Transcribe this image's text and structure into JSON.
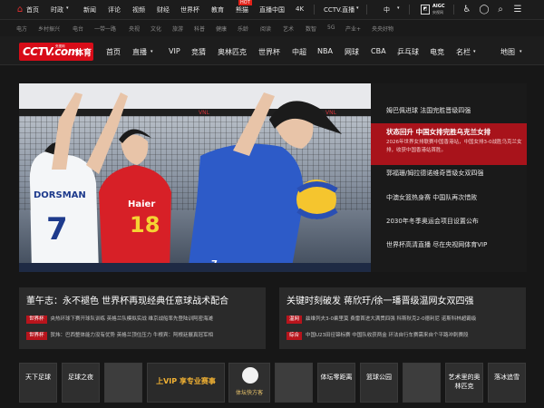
{
  "topbar": {
    "items": [
      "首页",
      "时政",
      "新闻",
      "评论",
      "视频",
      "财经",
      "世界杯",
      "教育",
      "熊猫",
      "直播中国",
      "4K",
      "CCTV.直播",
      "中"
    ],
    "hot_badge": "HOT",
    "aigc_label": "AIGC",
    "aigc_sub": "央视网",
    "icons": [
      "home-icon",
      "accessibility-icon",
      "user-icon",
      "search-icon",
      "menu-icon"
    ]
  },
  "subbar": {
    "items": [
      "电方",
      "乡村振兴",
      "电台",
      "一带一路",
      "央视",
      "文化",
      "旅游",
      "科普",
      "健康",
      "乐龄",
      "阅读",
      "艺术",
      "数智",
      "5G",
      "产业+",
      "央央好物"
    ]
  },
  "nav": {
    "logo_main": "CCTV.com",
    "logo_small": "央视网",
    "logo_suffix": "体育",
    "items": [
      "首页",
      "直播",
      "VIP",
      "竞猜",
      "奥林匹克",
      "世界杯",
      "中超",
      "NBA",
      "网球",
      "CBA",
      "乒乓球",
      "电竞",
      "名栏",
      "地图"
    ]
  },
  "hero": {
    "player_name": "DORSMAN",
    "player_number": "7",
    "player_number_red": "18",
    "sponsor": "Haier",
    "net_brand": "VNL"
  },
  "right_panel": {
    "items": [
      "姆巴佩进球 法国完胜晋级四强",
      "郭福珊/姆拉德诺维奇晋级女双四强",
      "中澳女篮热身赛 中国队再次惜败",
      "2030年冬季奥运会项目设置公布",
      "世界杯高清直播 尽在央视网体育VIP"
    ],
    "active": {
      "title": "状态回升 中国女排完胜乌克兰女排",
      "desc": "2026年世界女排联赛中国香港站，中国女排3-0战胜乌克兰女排，收获中国香港站首胜。"
    }
  },
  "cards": [
    {
      "title": "董午志：永不褪色 世界杯再现经典任意球战术配合",
      "rows": [
        {
          "tag": "世界杯",
          "text": "央热环球下赛开球队训练 英格兰队模拟实战 维京战船率先登陆训阿密海滩"
        },
        {
          "tag": "世界杯",
          "text": "贺炜：巴西整体能力没有优势 英格兰顶住压力 牛根宾：阿根廷展真冠军相"
        }
      ]
    },
    {
      "title": "关键时刻破发 蒋欣玗/徐一璠晋级温网女双四强",
      "rows": [
        {
          "tag": "温网",
          "text": "兹维列夫3-0乘里莫 费雷首进大满贯四强 科斯秋克2-0德利尼 诺斯科林超霸级"
        },
        {
          "tag": "综合",
          "text": "中国U23田径锦标赛 中国队收获两金 环法自行车赛需来自个平路冲刺赛段"
        }
      ]
    }
  ],
  "tiles": [
    {
      "label": "天下足球",
      "type": "text"
    },
    {
      "label": "足球之夜",
      "type": "text"
    },
    {
      "label": "",
      "type": "image"
    },
    {
      "label": "上VIP 享专业赛事",
      "type": "promo"
    },
    {
      "label": "体坛快方客",
      "type": "mascot"
    },
    {
      "label": "",
      "type": "image"
    },
    {
      "label": "体坛零距离",
      "type": "text"
    },
    {
      "label": "篮球公园",
      "type": "text"
    },
    {
      "label": "",
      "type": "image"
    },
    {
      "label": "艺术里的奥林匹克",
      "type": "text"
    },
    {
      "label": "落冰追雪",
      "type": "text"
    }
  ],
  "colors": {
    "brand_red": "#d80c18",
    "active_red": "#a8131b",
    "bg": "#171717"
  }
}
